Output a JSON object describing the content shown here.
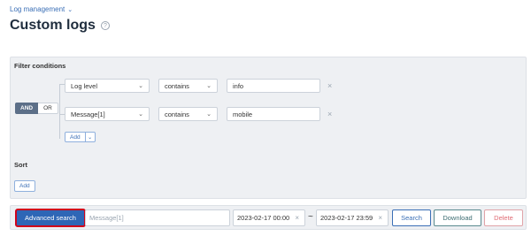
{
  "breadcrumb": {
    "label": "Log management"
  },
  "page": {
    "title": "Custom logs"
  },
  "filter": {
    "heading": "Filter conditions",
    "logic": {
      "and_label": "AND",
      "or_label": "OR",
      "selected": "AND"
    },
    "conditions": [
      {
        "field": "Log level",
        "operator": "contains",
        "value": "info"
      },
      {
        "field": "Message[1]",
        "operator": "contains",
        "value": "mobile"
      }
    ],
    "add_label": "Add"
  },
  "sort": {
    "heading": "Sort",
    "add_label": "Add"
  },
  "bottom": {
    "advanced_search_label": "Advanced search",
    "message_placeholder": "Message[1]",
    "date_from": "2023-02-17 00:00",
    "range_separator": "~",
    "date_to": "2023-02-17 23:59",
    "search_label": "Search",
    "download_label": "Download",
    "delete_label": "Delete"
  },
  "colors": {
    "primary": "#2e66b6",
    "highlight_border": "#d0021b",
    "panel_bg": "#eef0f3",
    "delete": "#e06c75"
  }
}
